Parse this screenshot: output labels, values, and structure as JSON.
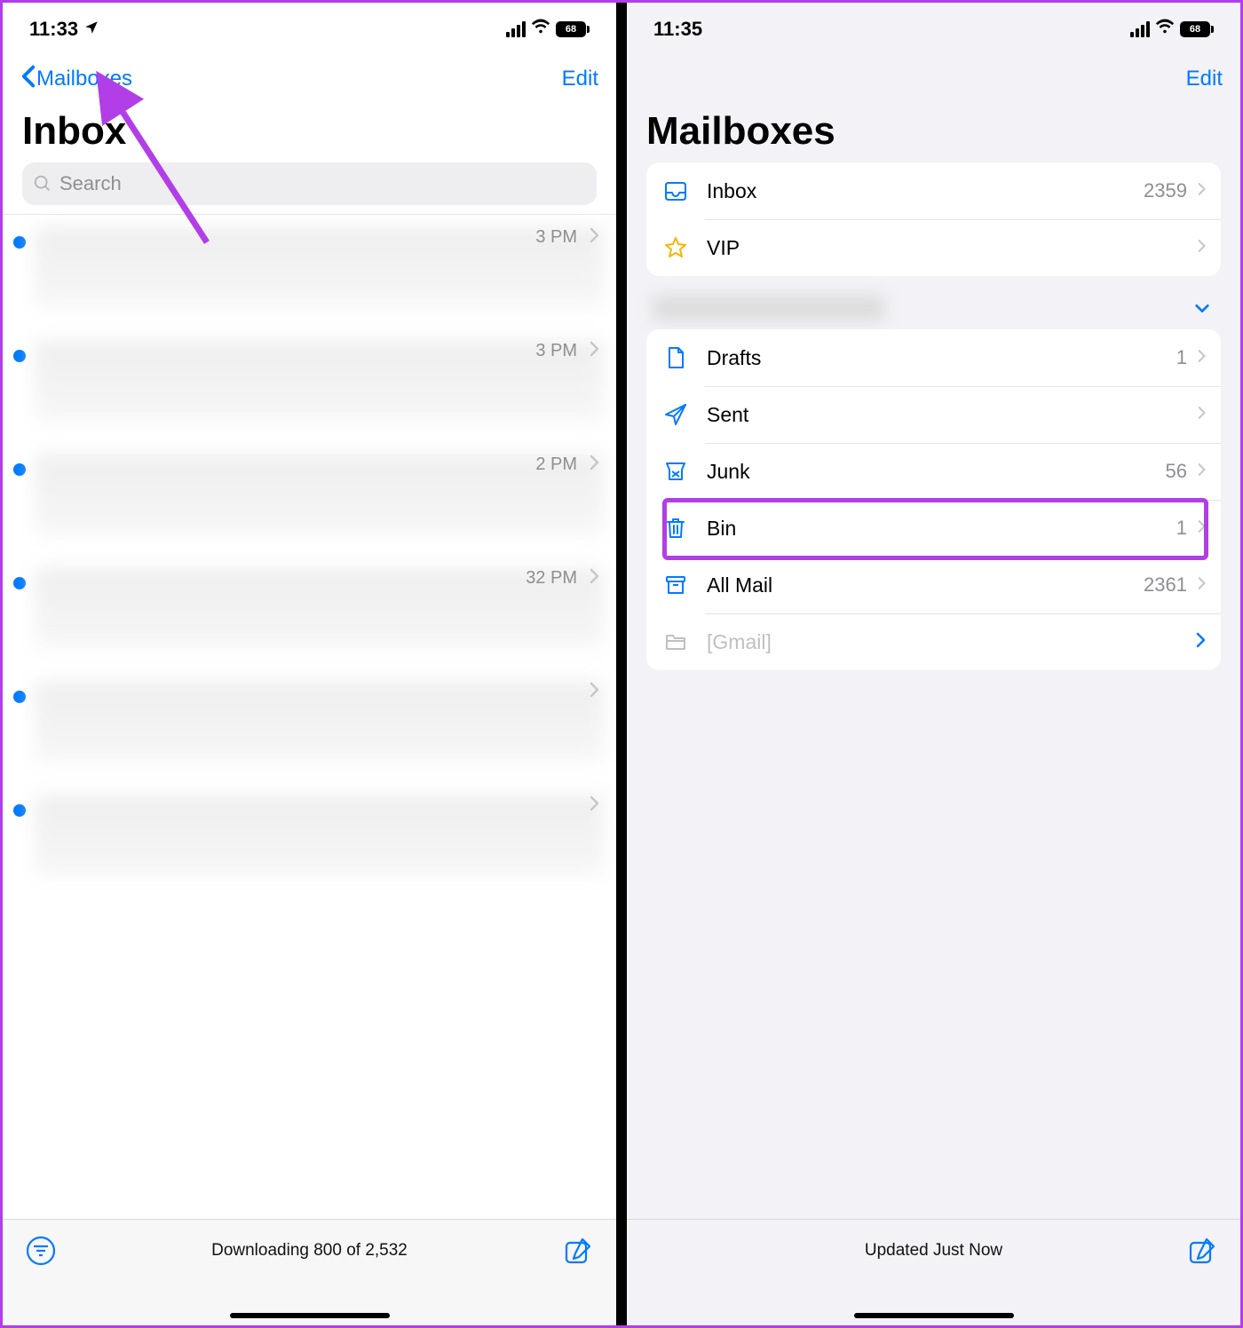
{
  "left": {
    "status": {
      "time": "11:33",
      "battery": "68"
    },
    "nav": {
      "back": "Mailboxes",
      "edit": "Edit"
    },
    "title": "Inbox",
    "search_placeholder": "Search",
    "messages": [
      {
        "time": "3 PM"
      },
      {
        "time": "3 PM"
      },
      {
        "time": "2 PM"
      },
      {
        "time": "32 PM"
      },
      {
        "time": ""
      },
      {
        "time": ""
      }
    ],
    "toolbar_status": "Downloading 800 of 2,532"
  },
  "right": {
    "status": {
      "time": "11:35",
      "battery": "68"
    },
    "nav": {
      "edit": "Edit"
    },
    "title": "Mailboxes",
    "top_boxes": [
      {
        "icon": "inbox",
        "label": "Inbox",
        "count": "2359"
      },
      {
        "icon": "star",
        "label": "VIP",
        "count": ""
      }
    ],
    "account_boxes": [
      {
        "icon": "draft",
        "label": "Drafts",
        "count": "1"
      },
      {
        "icon": "sent",
        "label": "Sent",
        "count": ""
      },
      {
        "icon": "junk",
        "label": "Junk",
        "count": "56"
      },
      {
        "icon": "trash",
        "label": "Bin",
        "count": "1",
        "highlight": true
      },
      {
        "icon": "archive",
        "label": "All Mail",
        "count": "2361"
      },
      {
        "icon": "folder",
        "label": "[Gmail]",
        "count": "",
        "muted": true,
        "blue_chev": true
      }
    ],
    "toolbar_status": "Updated Just Now"
  },
  "colors": {
    "accent": "#007aff",
    "annotation": "#b23ee8"
  }
}
